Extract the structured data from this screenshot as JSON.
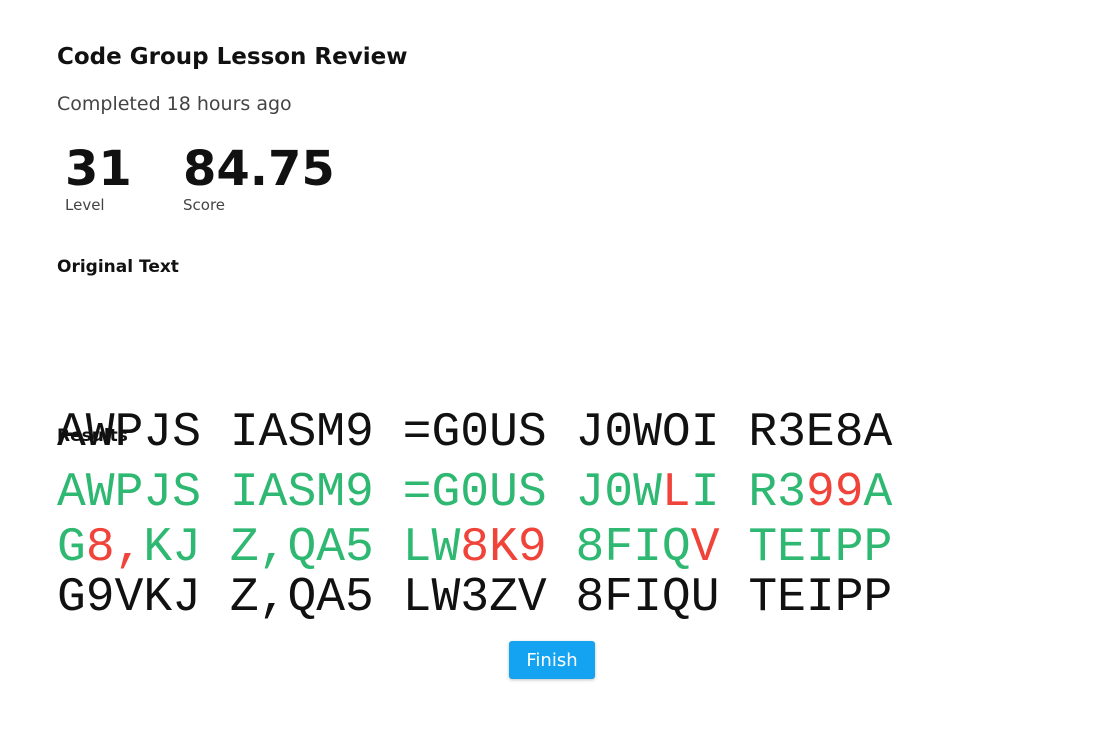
{
  "header": {
    "title": "Code Group Lesson Review",
    "subtitle": "Completed 18 hours ago"
  },
  "stats": {
    "level_value": "31",
    "level_label": "Level",
    "score_value": "84.75",
    "score_label": "Score"
  },
  "original": {
    "heading": "Original Text",
    "lines": [
      "AWPJS IASM9 =G0US J0WOI R3E8A",
      "G9VKJ Z,QA5 LW3ZV 8FIQU TEIPP"
    ]
  },
  "results": {
    "heading": "Results",
    "lines": [
      [
        {
          "text": "AWPJS IASM9 =G0US J0W",
          "status": "ok"
        },
        {
          "text": "L",
          "status": "bad"
        },
        {
          "text": "I R3",
          "status": "ok"
        },
        {
          "text": "99",
          "status": "bad"
        },
        {
          "text": "A",
          "status": "ok"
        }
      ],
      [
        {
          "text": "G",
          "status": "ok"
        },
        {
          "text": "8,",
          "status": "bad"
        },
        {
          "text": "KJ Z,QA5 LW",
          "status": "ok"
        },
        {
          "text": "8K9",
          "status": "bad"
        },
        {
          "text": " 8FIQ",
          "status": "ok"
        },
        {
          "text": "V",
          "status": "bad"
        },
        {
          "text": " TEIPP",
          "status": "ok"
        }
      ]
    ]
  },
  "finish": {
    "label": "Finish"
  },
  "colors": {
    "correct": "#2eb872",
    "incorrect": "#f0433a",
    "button": "#14a3f0"
  }
}
